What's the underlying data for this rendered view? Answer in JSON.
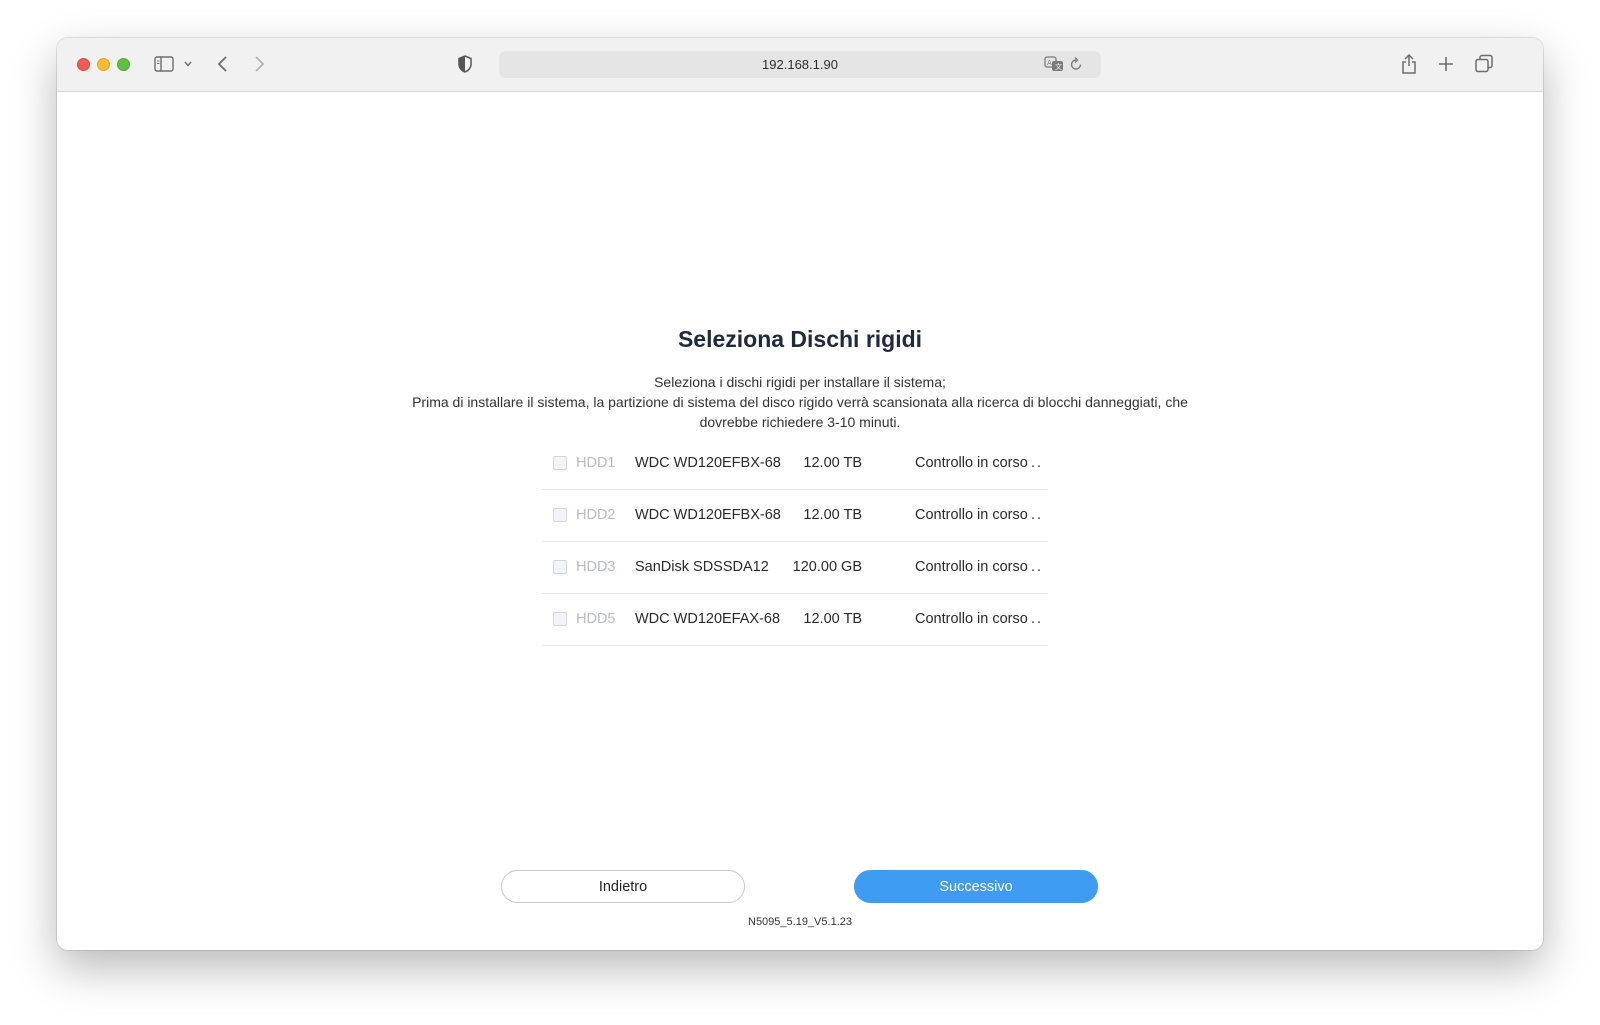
{
  "browser": {
    "url": "192.168.1.90"
  },
  "page": {
    "title": "Seleziona Dischi rigidi",
    "description_line1": "Seleziona i dischi rigidi per installare il sistema;",
    "description_line2": "Prima di installare il sistema, la partizione di sistema del disco rigido verrà scansionata alla ricerca di blocchi danneggiati, che dovrebbe richiedere 3-10 minuti.",
    "disks": [
      {
        "slot": "HDD1",
        "model": "WDC WD120EFBX-68",
        "size": "12.00 TB",
        "status": "Controllo in corso",
        "dots": ".."
      },
      {
        "slot": "HDD2",
        "model": "WDC WD120EFBX-68",
        "size": "12.00 TB",
        "status": "Controllo in corso",
        "dots": ".."
      },
      {
        "slot": "HDD3",
        "model": "SanDisk SDSSDA12",
        "size": "120.00 GB",
        "status": "Controllo in corso",
        "dots": ".."
      },
      {
        "slot": "HDD5",
        "model": "WDC WD120EFAX-68",
        "size": "12.00 TB",
        "status": "Controllo in corso",
        "dots": ".."
      }
    ],
    "back_label": "Indietro",
    "next_label": "Successivo",
    "version": "N5095_5.19_V5.1.23"
  },
  "colors": {
    "primary": "#3e9cf3",
    "title": "#1f2a3a",
    "slot_disabled": "#b9bcc4"
  },
  "icons": [
    "sidebar-icon",
    "chevron-down-icon",
    "back-arrow-icon",
    "forward-arrow-icon",
    "privacy-shield-icon",
    "translate-icon",
    "reload-icon",
    "share-icon",
    "new-tab-icon",
    "tab-overview-icon"
  ]
}
